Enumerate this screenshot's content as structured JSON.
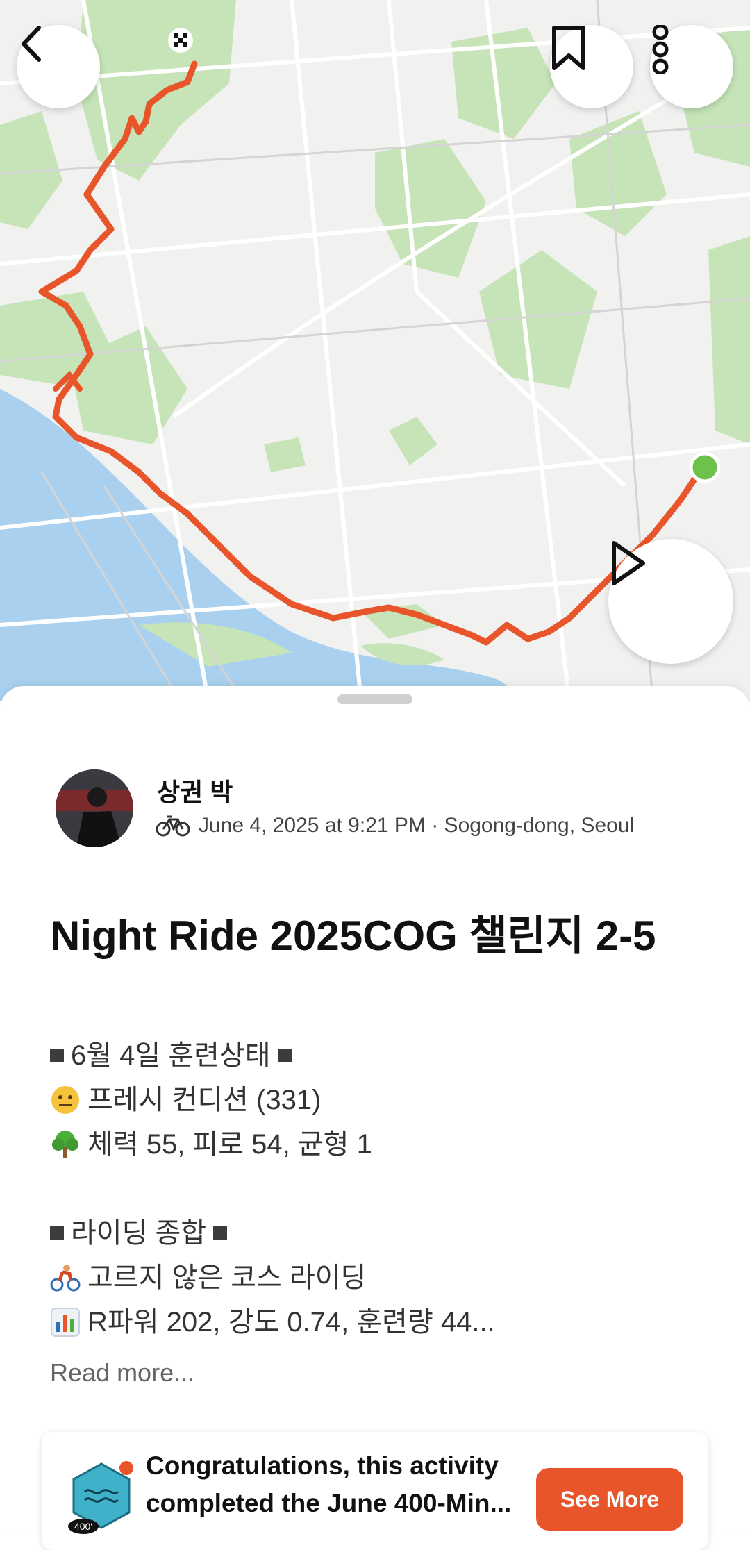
{
  "map": {
    "back_icon": "chevron-left-icon",
    "bookmark_icon": "bookmark-icon",
    "more_icon": "more-vertical-icon",
    "play_icon": "play-icon",
    "route_color": "#e8552a",
    "start_marker_color": "#6cc24a",
    "water_color": "#a9d1ef",
    "park_color": "#bfe2b0"
  },
  "activity": {
    "athlete_name": "상권 박",
    "sport_icon": "bicycle-icon",
    "meta": "June 4, 2025 at 9:21 PM · Sogong-dong, Seoul",
    "title": "Night Ride 2025COG 챌린지 2-5",
    "description_lines": [
      "6월 4일 훈련상태",
      "프레시 컨디션 (331)",
      "체력 55, 피로 54, 균형 1",
      "라이딩 종합",
      "고르지 않은 코스 라이딩",
      "R파워 202, 강도 0.74, 훈련량 44..."
    ],
    "read_more": "Read more..."
  },
  "challenge_card": {
    "badge_label": "400'",
    "line1": "Congratulations, this activity",
    "line2": "completed the June 400-Min...",
    "button": "See More",
    "accent": "#e8552a"
  }
}
